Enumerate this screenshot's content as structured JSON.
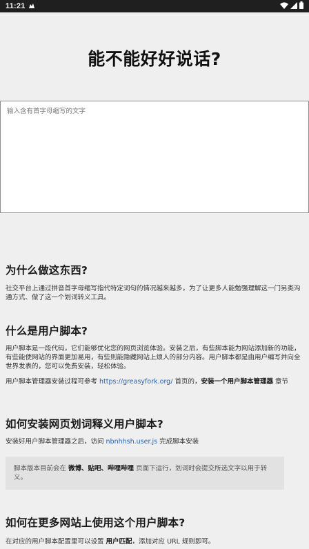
{
  "status_bar": {
    "time": "11:21",
    "icons": [
      "notification-icon",
      "wifi-icon",
      "cellular-signal-icon",
      "battery-icon"
    ]
  },
  "page": {
    "title": "能不能好好说话?",
    "input_placeholder": "输入含有首字母缩写的文字"
  },
  "sections": {
    "why": {
      "heading": "为什么做这东西?",
      "body": "社交平台上通过拼音首字母缩写指代特定词句的情况越来越多，为了让更多人能勉强理解这一门另类沟通方式、做了这一个划词转义工具。"
    },
    "userscript": {
      "heading": "什么是用户脚本?",
      "body1": "用户脚本是一段代码，它们能够优化您的网页浏览体验。安装之后，有些脚本能为网站添加新的功能，有些能使网站的界面更加易用，有些则能隐藏网站上烦人的部分内容。用户脚本都是由用户编写并向全世界发表的，您可以免费安装，轻松体验。",
      "body2_prefix": "用户脚本管理器安装过程可参考 ",
      "body2_link": "https://greasyfork.org/",
      "body2_middle": " 首页的，",
      "body2_bold": "安装一个用户脚本管理器",
      "body2_suffix": " 章节"
    },
    "install": {
      "heading": "如何安装网页划词释义用户脚本?",
      "body_prefix": "安装好用户脚本管理器之后，访问 ",
      "body_link": "nbnhhsh.user.js",
      "body_suffix": " 完成脚本安装",
      "note_prefix": "脚本版本目前会在 ",
      "note_bold": "微博、贴吧、哔哩哔哩",
      "note_suffix": " 页面下运行，划词时会提交所选文字以用于转义。"
    },
    "more_sites": {
      "heading": "如何在更多网站上使用这个用户脚本?",
      "body_prefix": "在对应的用户脚本配置里可以设置 ",
      "body_bold": "用户匹配",
      "body_suffix": "，添加对应 URL 规则即可。"
    }
  },
  "colors": {
    "background": "#efefef",
    "status_bar": "#1f1f1f",
    "link": "#2a5fb0",
    "note_background": "#e2e2e2"
  }
}
